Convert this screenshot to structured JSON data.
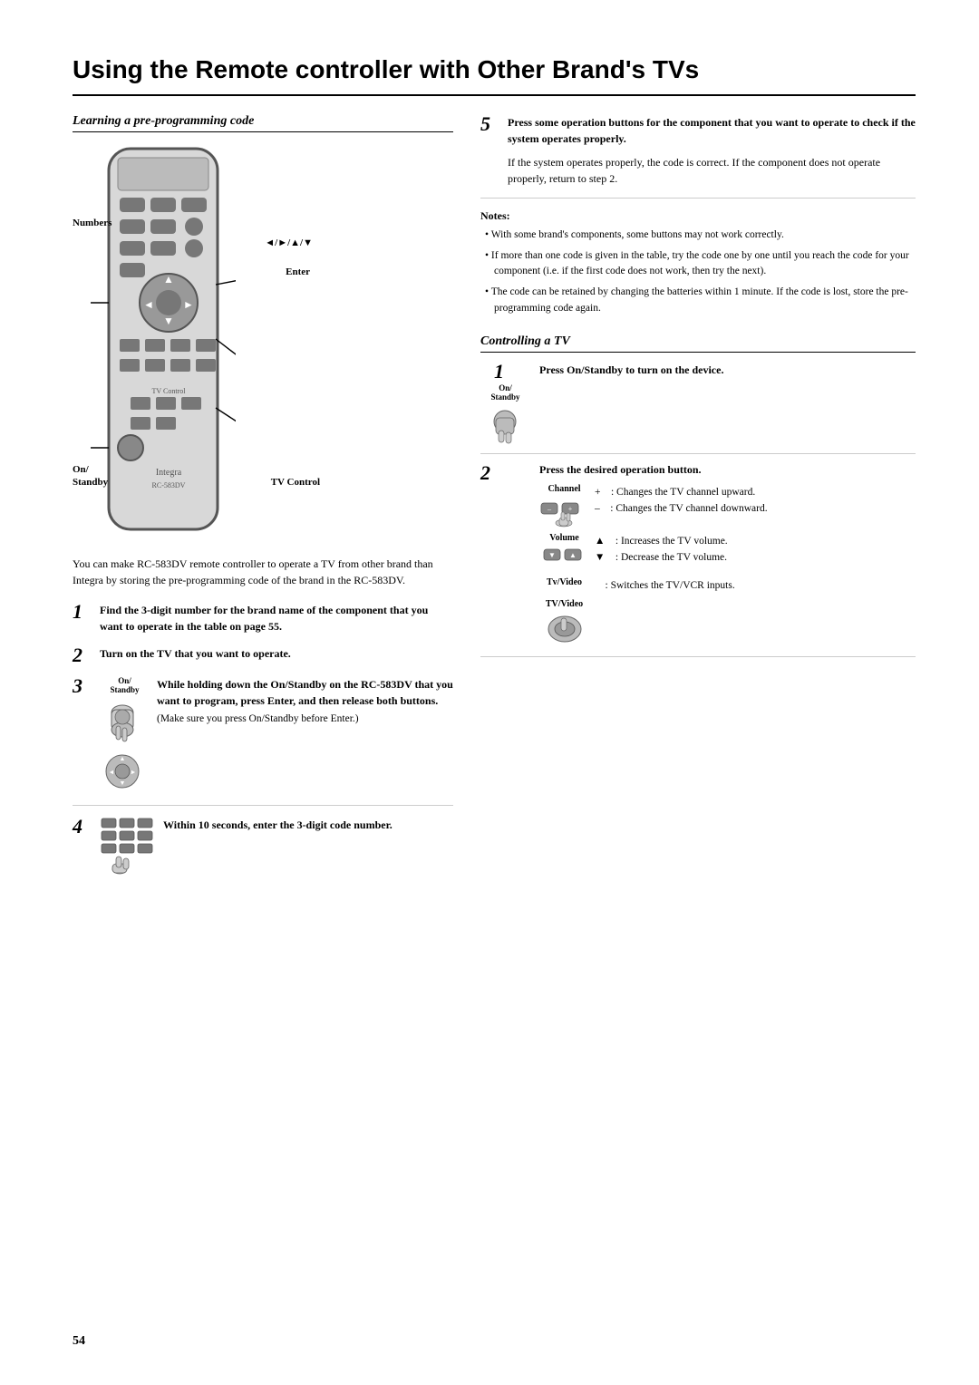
{
  "page": {
    "title": "Using the Remote controller with Other Brand's TVs",
    "page_number": "54"
  },
  "learning_section": {
    "title": "Learning a pre-programming code",
    "labels": {
      "numbers": "Numbers",
      "on_standby": "On/\nStandby",
      "enter": "Enter",
      "arrows": "◄/►/▲/▼",
      "tv_control": "TV Control"
    },
    "intro": "You can make RC-583DV remote controller to operate a TV from other brand than Integra by storing the pre-programming code of the brand in the RC-583DV.",
    "steps": [
      {
        "num": "1",
        "text": "Find the 3-digit number for the brand name of the component that you want to operate in the table on page 55."
      },
      {
        "num": "2",
        "text": "Turn on the TV that you want to operate."
      },
      {
        "num": "3",
        "has_icon": true,
        "text_bold": "While holding down the On/Standby on the RC-583DV that you want to program, press Enter, and then release both buttons.",
        "text_sub": "(Make sure you press On/Standby before Enter.)"
      },
      {
        "num": "4",
        "has_icon": true,
        "text": "Within 10 seconds, enter the 3-digit code number."
      }
    ]
  },
  "step5": {
    "num": "5",
    "title": "Press some operation buttons for the component that you want to operate to check if the system operates properly.",
    "body": "If the system operates properly, the code is correct. If the component does not operate properly, return to step 2."
  },
  "notes": {
    "title": "Notes:",
    "items": [
      "With some brand's components, some buttons may not work correctly.",
      "If more than one code is given in the table, try the code one by one until you reach the code for your component (i.e. if the first code does not work, then try the next).",
      "The code can be retained by changing the batteries within 1 minute. If the code is lost, store the pre-programming code again."
    ]
  },
  "controlling_tv": {
    "title": "Controlling a TV",
    "steps": [
      {
        "num": "1",
        "label": "On/\nStandby",
        "title_bold": "Press On/Standby to turn on the device."
      },
      {
        "num": "2",
        "title_bold": "Press the desired operation button.",
        "details": [
          {
            "icon_label": "Channel",
            "symbol": "+",
            "text": ": Changes the TV channel upward."
          },
          {
            "icon_label": "",
            "symbol": "–",
            "text": ": Changes the TV channel downward."
          },
          {
            "icon_label": "Volume",
            "symbol": "▲",
            "text": ": Increases the TV volume."
          },
          {
            "icon_label": "",
            "symbol": "▼",
            "text": ": Decrease the TV volume."
          },
          {
            "icon_label": "Tv/Video",
            "symbol": "",
            "text": ": Switches the TV/VCR inputs."
          }
        ]
      }
    ]
  }
}
